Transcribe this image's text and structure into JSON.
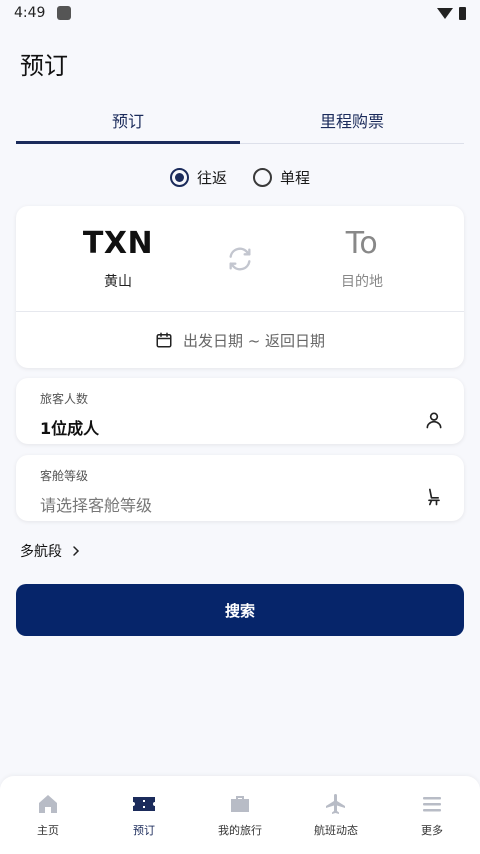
{
  "status_bar": {
    "time": "4:49"
  },
  "page_title": "预订",
  "tabs": [
    {
      "label": "预订",
      "active": true
    },
    {
      "label": "里程购票",
      "active": false
    }
  ],
  "trip_type": {
    "options": [
      {
        "label": "往返",
        "checked": true
      },
      {
        "label": "单程",
        "checked": false
      }
    ]
  },
  "route": {
    "origin": {
      "code": "TXN",
      "city": "黄山"
    },
    "destination": {
      "code": "To",
      "city": "目的地"
    },
    "dates": "出发日期 ~ 返回日期"
  },
  "passengers": {
    "label": "旅客人数",
    "value": "1位成人"
  },
  "cabin": {
    "label": "客舱等级",
    "placeholder": "请选择客舱等级"
  },
  "multi_leg": {
    "label": "多航段"
  },
  "search": {
    "label": "搜索"
  },
  "bottom_nav": [
    {
      "label": "主页",
      "icon": "home-icon",
      "active": false
    },
    {
      "label": "预订",
      "icon": "ticket-icon",
      "active": true
    },
    {
      "label": "我的旅行",
      "icon": "briefcase-icon",
      "active": false
    },
    {
      "label": "航班动态",
      "icon": "plane-icon",
      "active": false
    },
    {
      "label": "更多",
      "icon": "menu-icon",
      "active": false
    }
  ],
  "colors": {
    "primary": "#06256a",
    "accent": "#1b2b5b",
    "icon_gray": "#b8bcc6"
  }
}
